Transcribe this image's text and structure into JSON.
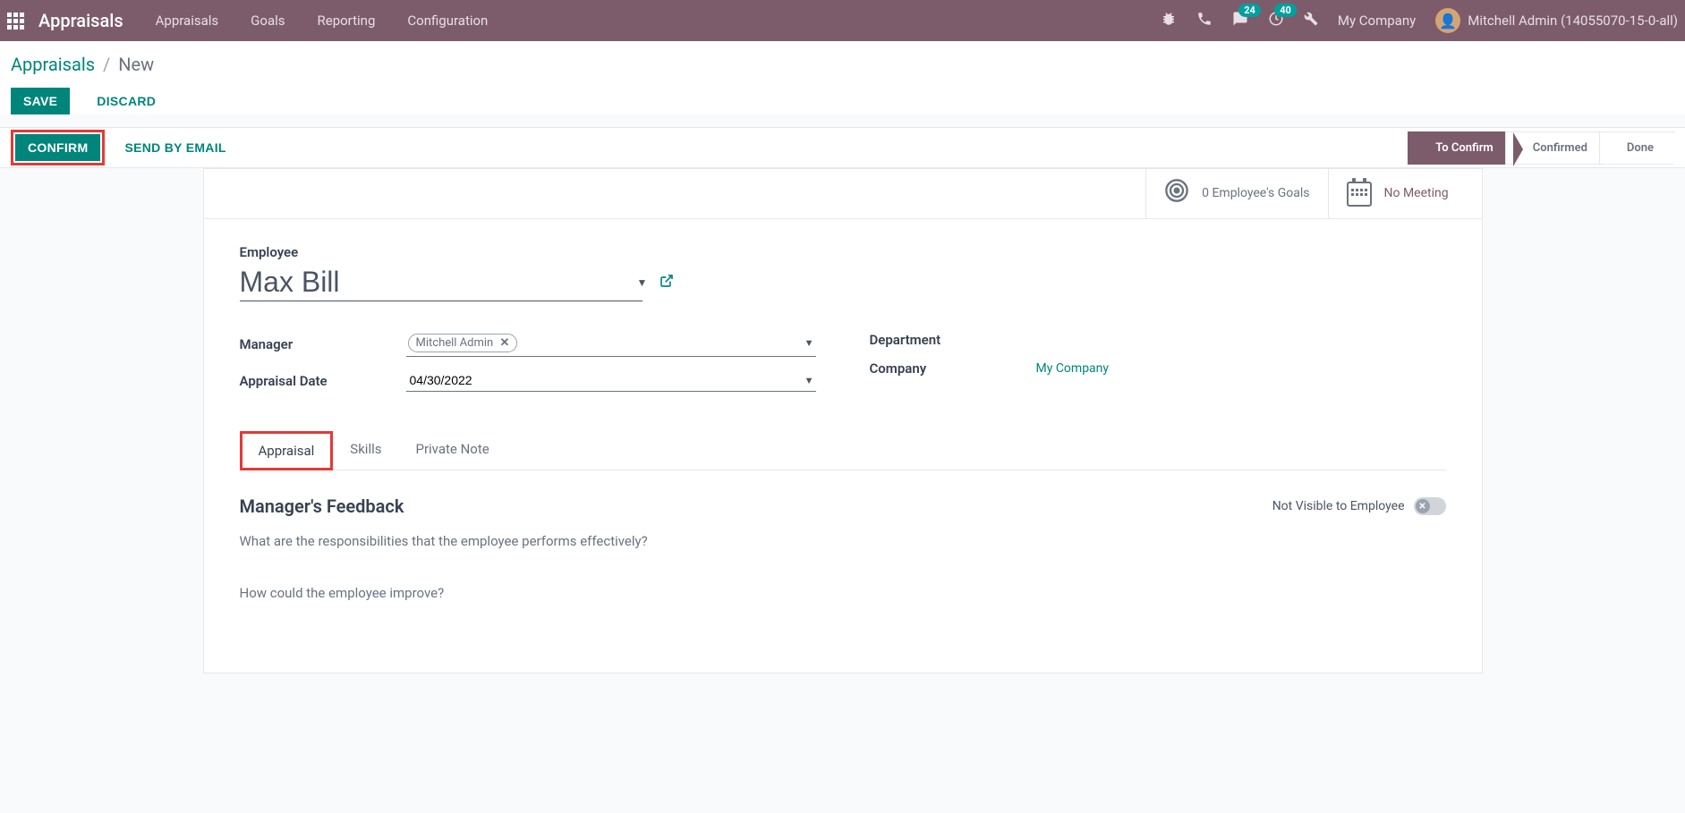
{
  "topnav": {
    "app_title": "Appraisals",
    "menus": [
      "Appraisals",
      "Goals",
      "Reporting",
      "Configuration"
    ],
    "messages_count": "24",
    "activities_count": "40",
    "company": "My Company",
    "user_name": "Mitchell Admin (14055070-15-0-all)"
  },
  "breadcrumb": {
    "root": "Appraisals",
    "current": "New"
  },
  "buttons": {
    "save": "Save",
    "discard": "Discard",
    "confirm": "Confirm",
    "send_email": "Send By Email"
  },
  "status": {
    "to_confirm": "To Confirm",
    "confirmed": "Confirmed",
    "done": "Done"
  },
  "stat": {
    "goals": "0 Employee's Goals",
    "meeting": "No Meeting"
  },
  "form": {
    "employee_label": "Employee",
    "employee_value": "Max Bill",
    "manager_label": "Manager",
    "manager_value": "Mitchell Admin",
    "date_label": "Appraisal Date",
    "date_value": "04/30/2022",
    "department_label": "Department",
    "department_value": "",
    "company_label": "Company",
    "company_value": "My Company"
  },
  "tabs": [
    "Appraisal",
    "Skills",
    "Private Note"
  ],
  "feedback": {
    "title": "Manager's Feedback",
    "visibility": "Not Visible to Employee",
    "q1": "What are the responsibilities that the employee performs effectively?",
    "q2": "How could the employee improve?"
  }
}
